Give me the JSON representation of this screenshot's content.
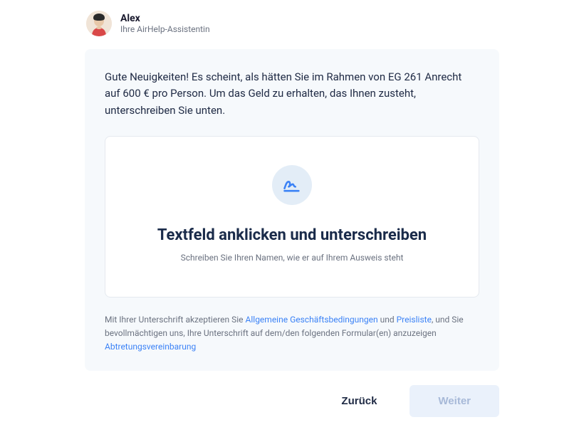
{
  "assistant": {
    "name": "Alex",
    "role": "Ihre AirHelp-Assistentin"
  },
  "intro": "Gute Neuigkeiten! Es scheint, als hätten Sie im Rahmen von EG 261 Anrecht auf 600 € pro Person. Um das Geld zu erhalten, das Ihnen zusteht, unterschreiben Sie unten.",
  "signature": {
    "title": "Textfeld anklicken und unterschreiben",
    "subtitle": "Schreiben Sie Ihren Namen, wie er auf Ihrem Ausweis steht"
  },
  "disclaimer": {
    "part1": "Mit Ihrer Unterschrift akzeptieren Sie ",
    "terms_link": "Allgemeine Geschäftsbedingungen",
    "part2": " und ",
    "pricelist_link": "Preisliste",
    "part3": ", und Sie bevollmächtigen uns, Ihre Unterschrift auf dem/den folgenden Formular(en) anzuzeigen ",
    "assignment_link": "Abtretungsvereinbarung"
  },
  "buttons": {
    "back": "Zurück",
    "next": "Weiter"
  }
}
